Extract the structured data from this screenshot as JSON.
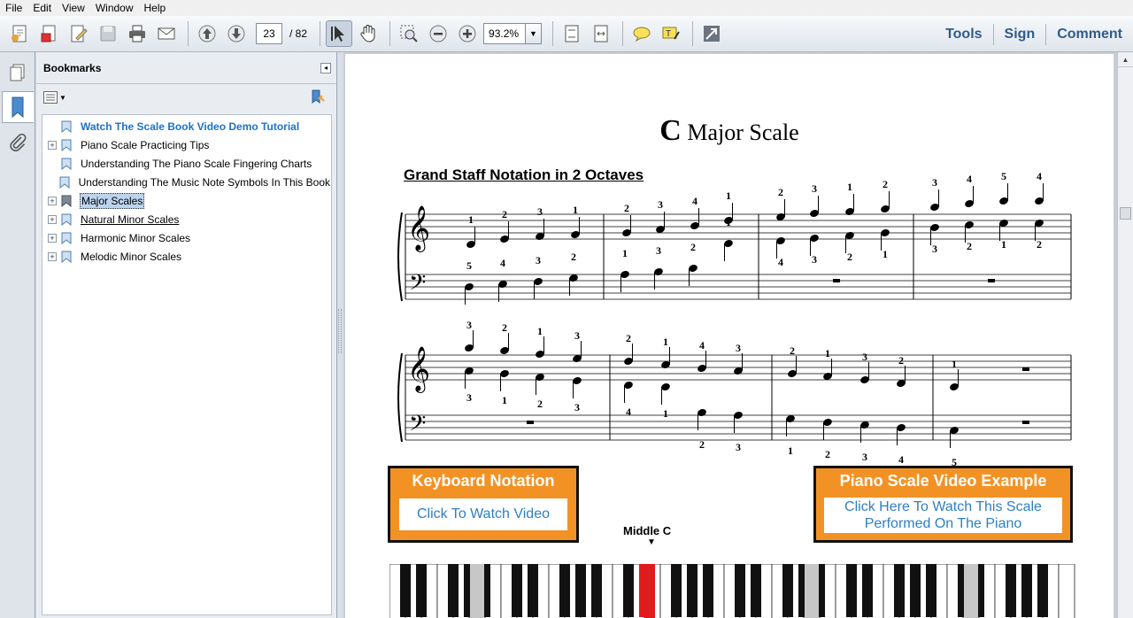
{
  "menu": [
    "File",
    "Edit",
    "View",
    "Window",
    "Help"
  ],
  "toolbar": {
    "page_current": "23",
    "page_total": "/ 82",
    "zoom": "93.2%",
    "links": [
      "Tools",
      "Sign",
      "Comment"
    ]
  },
  "bookmarks": {
    "title": "Bookmarks",
    "items": [
      {
        "label": "Watch The Scale Book Video Demo Tutorial",
        "expandable": false,
        "style": "link"
      },
      {
        "label": "Piano Scale Practicing Tips",
        "expandable": true,
        "style": "normal"
      },
      {
        "label": "Understanding The Piano Scale Fingering Charts",
        "expandable": false,
        "style": "normal"
      },
      {
        "label": "Understanding The Music Note Symbols In This Book",
        "expandable": false,
        "style": "normal"
      },
      {
        "label": "Major Scales",
        "expandable": true,
        "style": "selected"
      },
      {
        "label": "Natural Minor Scales",
        "expandable": true,
        "style": "normal"
      },
      {
        "label": "Harmonic Minor Scales",
        "expandable": true,
        "style": "normal"
      },
      {
        "label": "Melodic Minor Scales",
        "expandable": true,
        "style": "normal"
      }
    ]
  },
  "document": {
    "title_letter": "C",
    "title_rest": "Major Scale",
    "subtitle": "Grand Staff Notation in 2 Octaves",
    "system1": {
      "treble_fingers_above": [
        "1",
        "2",
        "3",
        "1",
        "2",
        "3",
        "4",
        "1",
        "2",
        "3",
        "1",
        "2",
        "3",
        "4",
        "5",
        "4"
      ],
      "treble_fingers_below": [
        "4",
        "3",
        "2",
        "1",
        "3",
        "2",
        "1",
        "2"
      ],
      "bass_fingers_above": [
        "5",
        "4",
        "3",
        "2",
        "1",
        "3",
        "2",
        "1"
      ]
    },
    "system2": {
      "treble_fingers_above": [
        "3",
        "2",
        "1",
        "3",
        "2",
        "1",
        "4",
        "3",
        "2",
        "1",
        "3",
        "2",
        "1"
      ],
      "treble_fingers_below": [
        "3",
        "1",
        "2",
        "3",
        "4",
        "1"
      ],
      "bass_fingers_below": [
        "2",
        "3",
        "1",
        "2",
        "3",
        "4",
        "5"
      ]
    },
    "keyboard_box": {
      "header": "Keyboard Notation",
      "link": "Click To Watch Video"
    },
    "video_box": {
      "header": "Piano Scale Video Example",
      "link_line1": "Click Here To Watch This Scale",
      "link_line2": "Performed On The Piano"
    },
    "middle_c_label": "Middle C"
  },
  "colors": {
    "accent_orange": "#f39224",
    "link_blue": "#2e7fc4",
    "highlight_red": "#e01b1b",
    "toolbar_link": "#2e5c8a"
  }
}
